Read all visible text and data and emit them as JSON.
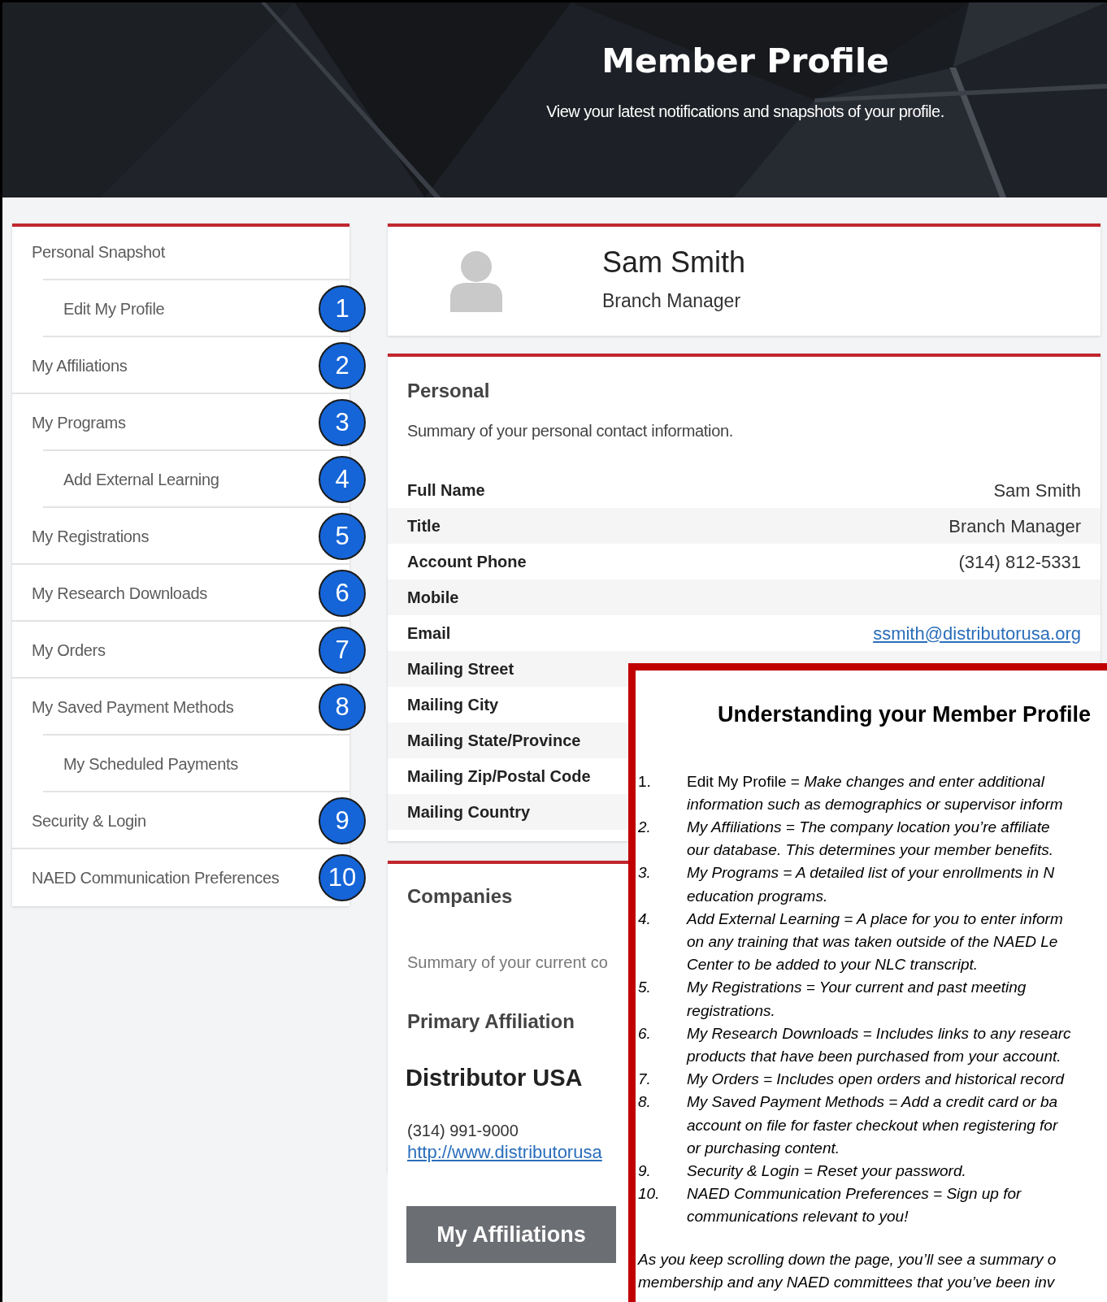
{
  "header": {
    "title": "Member Profile",
    "subtitle": "View your latest notifications and snapshots of your profile."
  },
  "sidebar": {
    "items": [
      {
        "label": "Personal Snapshot",
        "children": [
          {
            "label": "Edit My Profile",
            "badge": "1"
          }
        ]
      },
      {
        "label": "My Affiliations",
        "badge": "2"
      },
      {
        "label": "My Programs",
        "badge": "3",
        "children": [
          {
            "label": "Add External Learning",
            "badge": "4"
          }
        ]
      },
      {
        "label": "My Registrations",
        "badge": "5"
      },
      {
        "label": "My Research Downloads",
        "badge": "6"
      },
      {
        "label": "My Orders",
        "badge": "7"
      },
      {
        "label": "My Saved Payment Methods",
        "badge": "8",
        "children": [
          {
            "label": "My Scheduled Payments"
          }
        ]
      },
      {
        "label": "Security & Login",
        "badge": "9"
      },
      {
        "label": "NAED Communication Preferences",
        "badge": "10"
      }
    ]
  },
  "profile": {
    "name": "Sam Smith",
    "title": "Branch Manager"
  },
  "personal": {
    "heading": "Personal",
    "summary": "Summary of your personal contact information.",
    "rows": [
      {
        "label": "Full Name",
        "value": "Sam Smith"
      },
      {
        "label": "Title",
        "value": "Branch Manager"
      },
      {
        "label": "Account Phone",
        "value": "(314) 812-5331"
      },
      {
        "label": "Mobile"
      },
      {
        "label": "Email",
        "value": "ssmith@distributorusa.org",
        "kind": "link"
      },
      {
        "label": "Mailing Street"
      },
      {
        "label": "Mailing City"
      },
      {
        "label": "Mailing State/Province"
      },
      {
        "label": "Mailing Zip/Postal Code"
      },
      {
        "label": "Mailing Country"
      }
    ]
  },
  "companies": {
    "heading": "Companies",
    "summary": "Summary of your current co",
    "subheading": "Primary Affiliation",
    "company": "Distributor USA",
    "phone": "(314) 991-9000",
    "website": "http://www.distributorusa",
    "button": "My Affiliations"
  },
  "overlay": {
    "title": "Understanding your Member Profile",
    "items": [
      {
        "number": "1.",
        "lines": [
          "Edit My Profile = *Make changes and enter additional*",
          "*information such as demographics or supervisor inform*"
        ]
      },
      {
        "number": "2.",
        "lines": [
          "My Affiliations = The company location you’re affiliate",
          "our database. This determines your member benefits."
        ]
      },
      {
        "number": "3.",
        "lines": [
          "My Programs = A detailed list of your enrollments in N",
          "education programs."
        ]
      },
      {
        "number": "4.",
        "lines": [
          "Add External Learning = A place for you to enter inform",
          "on any training that was taken outside of the NAED Le",
          "Center to be added to your NLC transcript."
        ]
      },
      {
        "number": "5.",
        "lines": [
          "My Registrations = Your current and past meeting",
          "registrations."
        ]
      },
      {
        "number": "6.",
        "lines": [
          "My Research Downloads = Includes links to any researc",
          "products that have been purchased from your account."
        ]
      },
      {
        "number": "7.",
        "lines": [
          "My Orders = Includes open orders and historical record"
        ]
      },
      {
        "number": "8.",
        "lines": [
          "My Saved Payment Methods = Add a credit card or ba",
          "account on file for faster checkout when registering for",
          "or purchasing content."
        ]
      },
      {
        "number": "9.",
        "lines": [
          "Security & Login = Reset your password."
        ]
      },
      {
        "number": "10.",
        "lines": [
          "NAED Communication Preferences = Sign up for",
          "communications relevant to you!"
        ]
      }
    ],
    "footer": [
      "As you keep scrolling down the page, you’ll see a summary o",
      "membership and any NAED committees that you’ve been inv"
    ]
  }
}
